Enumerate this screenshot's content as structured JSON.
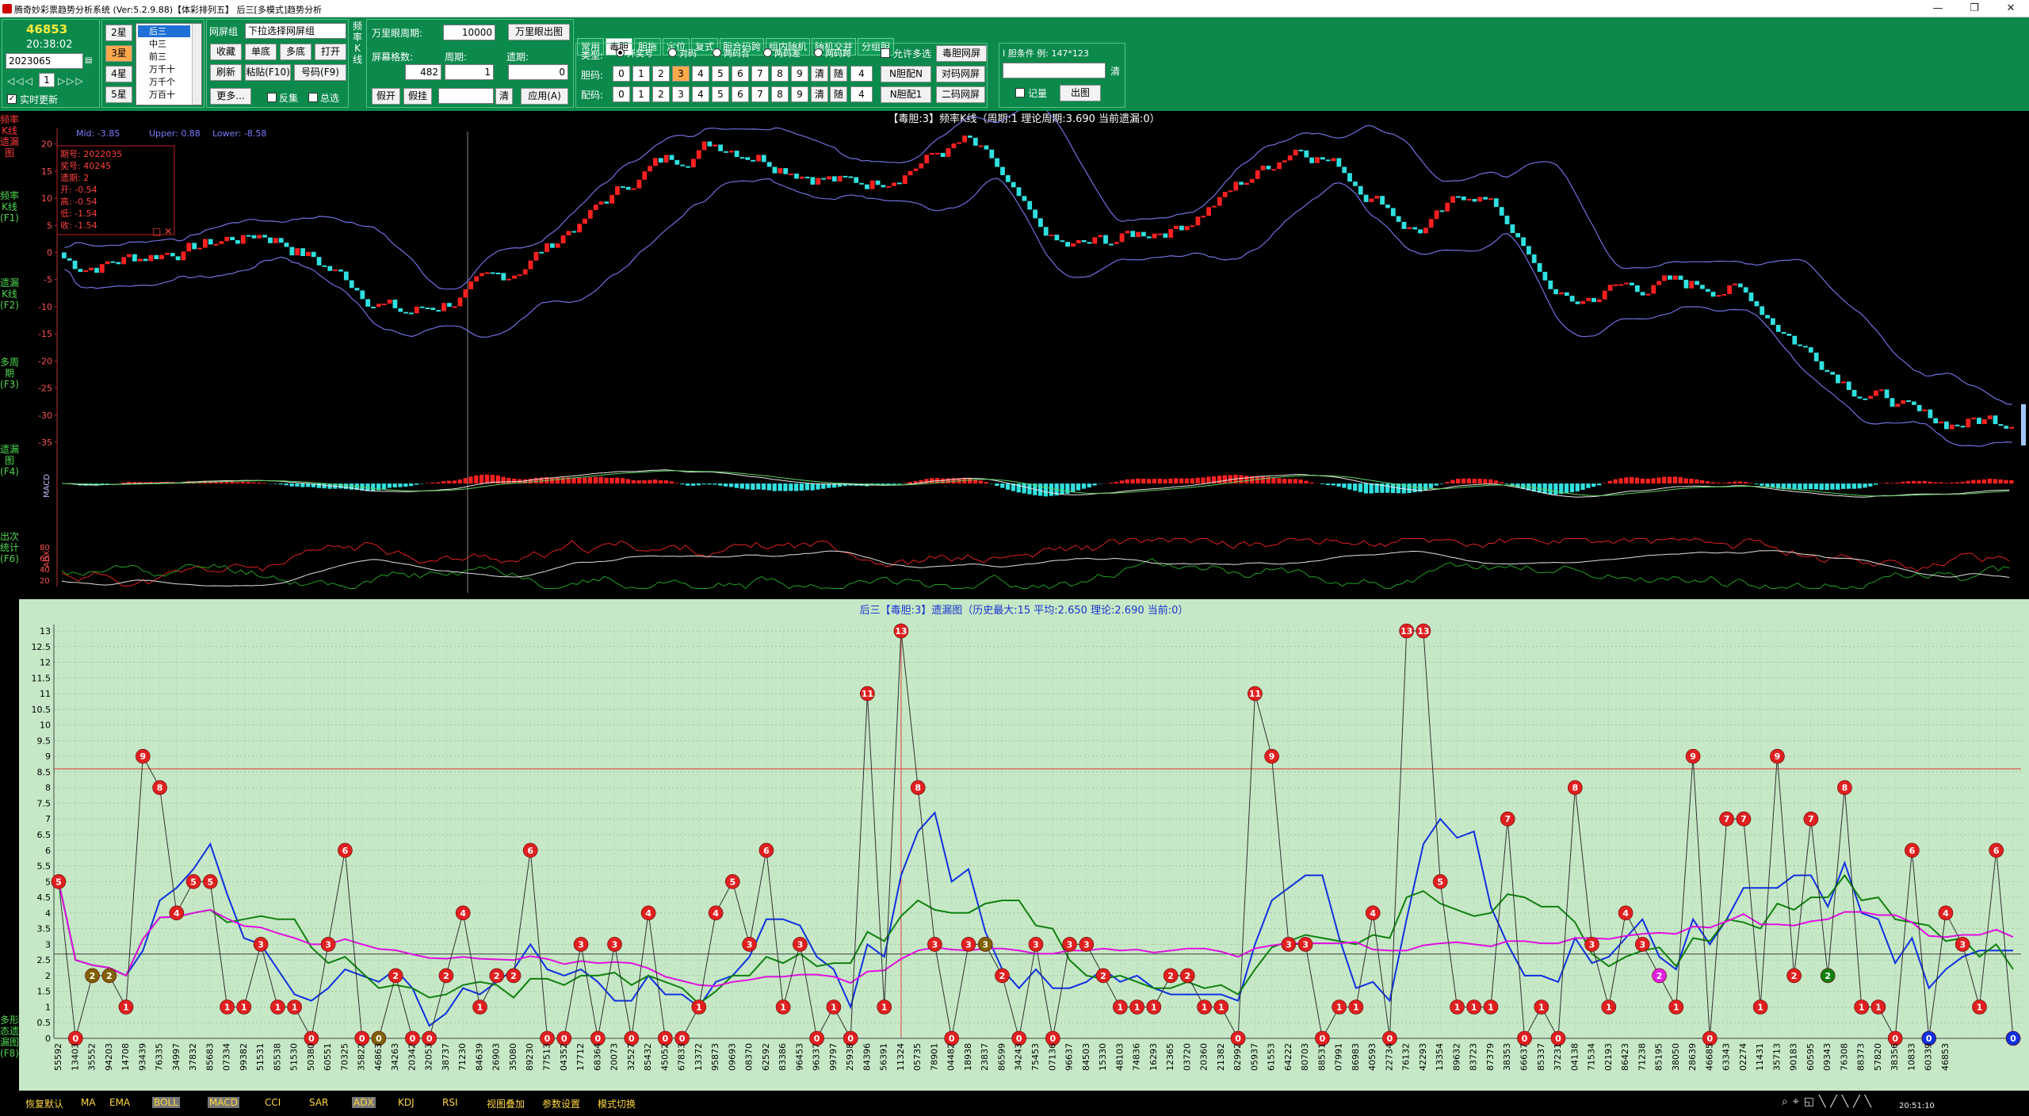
{
  "window": {
    "title": "腾奇妙彩票趋势分析系统 (Ver:5.2.9.88)【体彩排列五】 后三[多模式]趋势分析",
    "minimize": "—",
    "maximize": "❐",
    "close": "✕"
  },
  "left_panel": {
    "big_number": "46853",
    "clock": "20:38:02",
    "issue": "2023065",
    "realtime_label": "实时更新",
    "star_buttons": [
      "2星",
      "3星",
      "4星",
      "5星"
    ],
    "active_star": "3星",
    "list_items": [
      "后三",
      "中三",
      "前三",
      "万千十",
      "万千个",
      "万百十"
    ],
    "selected_list_item": "后三",
    "page_number": "1"
  },
  "pool_group": {
    "label": "网屏组",
    "select_value": "下拉选择网屏组",
    "buttons": [
      "收藏",
      "单底",
      "多底",
      "打开",
      "刷新",
      "粘贴(F10)",
      "号码(F9)"
    ],
    "more": "更多...",
    "checkbox_fanji": "反集",
    "checkbox_zongxuan": "总选"
  },
  "kline_vertical_label": "频率K线",
  "wanli": {
    "period_label": "万里眼周期:",
    "period_value": "10000",
    "button": "万里眼出图",
    "screen_count_label": "屏幕格数:",
    "screen_count_value": "482",
    "cycle_label": "周期:",
    "cycle_value": "1",
    "miss_label": "遗期:",
    "miss_value": "0",
    "buttons": [
      "假开",
      "假挂",
      "清",
      "应用(A)"
    ]
  },
  "tabs": [
    "常用",
    "毒胆",
    "胆拖",
    "定位",
    "复式",
    "胆合码跨",
    "组内随机",
    "随机交并",
    "分组胆"
  ],
  "active_tab": "毒胆",
  "dan": {
    "type_label": "类型:",
    "types": [
      "开奖号",
      "对码",
      "两码合",
      "两码差",
      "两码跨"
    ],
    "active_type": "开奖号",
    "allow_multi": "允许多选",
    "dan_row_label": "胆码:",
    "pei_row_label": "配码:",
    "digits": [
      "0",
      "1",
      "2",
      "3",
      "4",
      "5",
      "6",
      "7",
      "8",
      "9"
    ],
    "active_digit": "3",
    "clear": "清",
    "random": "随",
    "count": "4",
    "btn_row1": [
      "毒胆网屏",
      "N胆配N",
      "N胆配1"
    ],
    "btn_row2": [
      "对码网屏",
      "二码网屏"
    ]
  },
  "condition": {
    "label": "I 胆条件  例: 147*123",
    "clear": "清",
    "checkbox": "记量",
    "button": "出图"
  },
  "kchart": {
    "title": "【毒胆:3】频率K线（周期:1 理论周期:3.690 当前遗漏:0）",
    "boll_label_mid": "Mid: -3.85",
    "boll_label_upper": "Upper: 0.88",
    "boll_label_lower": "Lower: -8.58",
    "tooltip": [
      "期号: 2022035",
      "奖号: 40245",
      "遗期: 2",
      "开: -0.54",
      "高: -0.54",
      "低: -1.54",
      "收: -1.54"
    ],
    "yticks": [
      20,
      15,
      10,
      5,
      0,
      -5,
      -10,
      -15,
      -20,
      -25,
      -30,
      -35
    ],
    "macd_label": "MACD",
    "adx_label": "ADX",
    "adx_ticks": [
      80,
      60,
      40,
      20
    ],
    "colors": {
      "up": "#ff2020",
      "down": "#30e0e0",
      "band": "#7070e0",
      "macd_fast": "#e8e8e8",
      "macd_slow": "#60d060"
    }
  },
  "left_tabs": [
    "频率K线遗漏图",
    "频率K线(F1)",
    "遗漏K线(F2)",
    "多周期(F3)",
    "遗漏图(F4)",
    "出次统计(F6)",
    "多形态遗漏图(F8)"
  ],
  "miss_chart": {
    "title": "后三【毒胆:3】遗漏图（历史最大:15 平均:2.650 理论:2.690 当前:0）",
    "yticks": [
      13,
      12.5,
      12,
      11.5,
      11,
      10.5,
      10,
      9.5,
      9,
      8.5,
      8,
      7.5,
      7,
      6.5,
      6,
      5.5,
      5,
      4.5,
      4,
      3.5,
      3,
      2.5,
      2,
      1.5,
      1,
      0.5,
      0
    ],
    "x_labels": [
      "55592",
      "13403",
      "35552",
      "94203",
      "14708",
      "93439",
      "76335",
      "34997",
      "37832",
      "85683",
      "07334",
      "99382",
      "51531",
      "85538",
      "51530",
      "50380",
      "60551",
      "70325",
      "35822",
      "46863",
      "34263",
      "20342",
      "32053",
      "38737",
      "71230",
      "84639",
      "26903",
      "35080",
      "89230",
      "77513",
      "04352",
      "17712",
      "68364",
      "20073",
      "32527",
      "85432",
      "45052",
      "67833",
      "13372",
      "95873",
      "09693",
      "08370",
      "62592",
      "83386",
      "96453",
      "96337",
      "99797",
      "25938",
      "84396",
      "56391",
      "11324",
      "05735",
      "78901",
      "04482",
      "18938",
      "23837",
      "86599",
      "34243",
      "75453",
      "07136",
      "96637",
      "84503",
      "15330",
      "48103",
      "74836",
      "16293",
      "12365",
      "03720",
      "20360",
      "21382",
      "82992",
      "05937",
      "61553",
      "64222",
      "80703",
      "88531",
      "07991",
      "86983",
      "40593",
      "22734",
      "76132",
      "42293",
      "13354",
      "89632",
      "83723",
      "87379",
      "38353",
      "66637",
      "85337",
      "37231",
      "04138",
      "71534",
      "02193",
      "86423",
      "71238",
      "85195",
      "38050",
      "28639",
      "46685",
      "63343",
      "02274",
      "11431",
      "35713",
      "90183",
      "60595",
      "09343",
      "76308",
      "88373",
      "57820",
      "38356",
      "10833",
      "60339",
      "46853"
    ],
    "values": [
      5,
      0,
      2,
      2,
      1,
      9,
      8,
      4,
      5,
      5,
      1,
      1,
      3,
      1,
      1,
      0,
      3,
      6,
      0,
      0,
      2,
      0,
      0,
      2,
      4,
      1,
      2,
      2,
      6,
      0,
      0,
      3,
      0,
      3,
      0,
      4,
      0,
      0,
      1,
      4,
      5,
      3,
      6,
      1,
      3,
      0,
      1,
      0,
      11,
      1,
      13,
      8,
      3,
      0,
      3,
      3,
      2,
      0,
      3,
      0,
      3,
      3,
      2,
      1,
      1,
      1,
      2,
      2,
      1,
      1,
      0,
      11,
      9,
      3,
      3,
      0,
      1,
      1,
      4,
      0,
      13,
      13,
      5,
      1,
      1,
      1,
      7,
      0,
      1,
      0,
      8,
      3,
      1,
      4,
      3,
      2,
      1,
      9,
      0,
      7,
      7,
      1,
      9,
      2,
      7,
      2,
      8,
      1,
      1,
      0,
      6,
      0,
      4,
      3,
      1,
      6,
      0
    ],
    "highlight_index": 95,
    "mark_special": {
      "111": "blue",
      "116": "blue",
      "105": "green",
      "95": "magenta",
      "2": "olive",
      "3": "olive",
      "19": "olive",
      "55": "olive"
    },
    "ref_high": 8.6,
    "ref_mid": 2.69,
    "colors": {
      "points": "#e02020",
      "ma_blue": "#1030e0",
      "ma_green": "#108010",
      "ma_magenta": "#e010e0",
      "line": "#303030"
    }
  },
  "status_items": [
    "恢复默认",
    "MA",
    "EMA",
    "BOLL",
    "MACD",
    "CCI",
    "SAR",
    "ADX",
    "KDJ",
    "RSI",
    "视图叠加",
    "参数设置",
    "模式切换"
  ],
  "status_active": [
    "BOLL",
    "MACD",
    "ADX"
  ],
  "status_time": "20:51:10"
}
